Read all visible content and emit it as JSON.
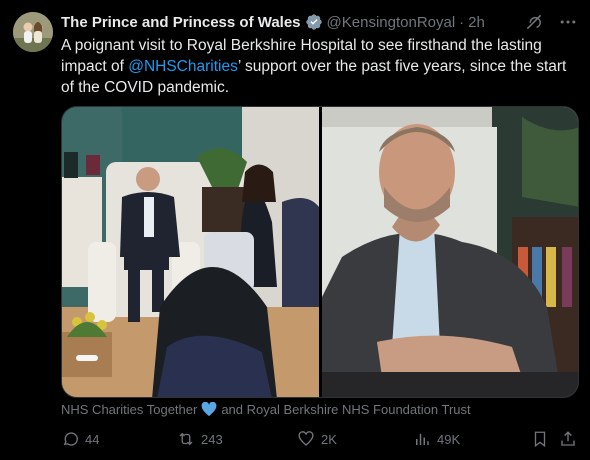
{
  "author": {
    "name": "The Prince and Princess of Wales",
    "handle": "@KensingtonRoyal",
    "separator": "·",
    "time": "2h"
  },
  "tweet": {
    "text_part1": "A poignant visit to Royal Berkshire Hospital to see firsthand the lasting impact of ",
    "mention": "@NHSCharities",
    "text_part2": "’ support over the past five years, since the start of the COVID pandemic."
  },
  "tags": {
    "tag1": "NHS Charities Together",
    "tag2": "and Royal Berkshire NHS Foundation Trust"
  },
  "actions": {
    "replies": "44",
    "reposts": "243",
    "likes": "2K",
    "views": "49K"
  },
  "icons": {
    "verified": "verified-badge-icon",
    "grok": "grok-icon",
    "more": "more-icon",
    "reply": "reply-icon",
    "repost": "repost-icon",
    "like": "heart-icon",
    "views": "views-icon",
    "bookmark": "bookmark-icon",
    "share": "share-icon"
  },
  "colors": {
    "accent": "#1d9bf0",
    "muted": "#71767b",
    "text": "#e7e9ea",
    "background": "#000000"
  }
}
